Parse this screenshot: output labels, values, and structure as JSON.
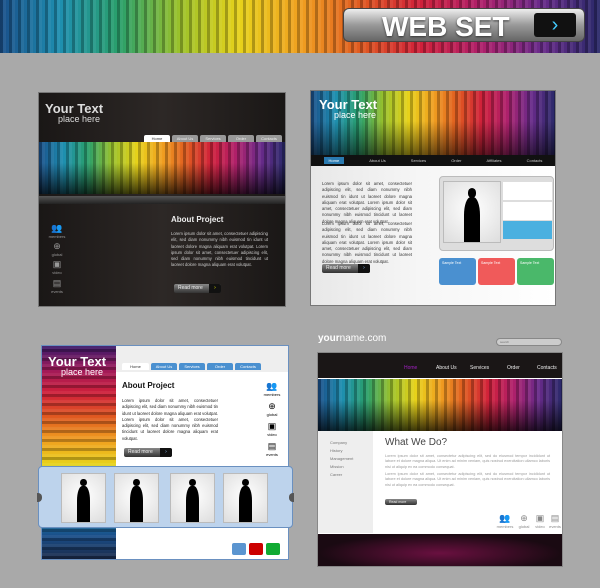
{
  "banner": {
    "title": "WEB SET",
    "arrow_icon": "chevron-right-icon"
  },
  "lorem1": "Lorem ipsum dolor sit amet, consectetuer adipiscing elit, sed diam nonummy nibh euismod tin idunt ut laoreet dolore magna aliquam erat volutpat. Lorem ipsum dolor sit amet, consectetuer adipiscing elit, sed diam nonummy nibh euismod tincidunt ut laoreet dolore magna aliquam erat volutpat.",
  "lorem2": "Lorem ipsum dolor sit amet, consectetur adipiscing elit, sed do eiusmod tempor incididunt ut labore et dolore magna aliqua. Ut enim ad minim veniam, quis nostrud exercitation ullamco laboris nisi ut aliquip ex ea commodo consequat.",
  "t1": {
    "logo1": "Your Text",
    "logo2": "place here",
    "tabs": [
      "Home",
      "About Us",
      "Services",
      "Order",
      "Contacts"
    ],
    "heading": "About Project",
    "button": "Read more",
    "icons": [
      "members",
      "global",
      "video",
      "events"
    ]
  },
  "t2": {
    "logo1": "Your Text",
    "logo2": "place here",
    "nav": [
      "Home",
      "About Us",
      "Services",
      "Order",
      "Affiliates",
      "Contacts"
    ],
    "button": "Read more",
    "cards": [
      "Sample Text",
      "Sample Text",
      "Sample Text"
    ],
    "card_colors": [
      "#4a90d0",
      "#f05a5a",
      "#4ab86a"
    ]
  },
  "t3": {
    "logo1": "Your Text",
    "logo2": "place here",
    "tabs": [
      "Home",
      "About Us",
      "Services",
      "Order",
      "Contacts"
    ],
    "heading": "About Project",
    "button": "Read more",
    "icons": [
      "members",
      "global",
      "video",
      "events"
    ],
    "swatches": [
      "#5b95d0",
      "#cc0000",
      "#11aa33"
    ]
  },
  "t4": {
    "domain_bold": "your",
    "domain_rest": "name.com",
    "search_placeholder": "search",
    "nav": [
      "Home",
      "About Us",
      "Services",
      "Order",
      "Contacts"
    ],
    "side": [
      "Company",
      "History",
      "Management",
      "Mission",
      "Career"
    ],
    "heading": "What We Do?",
    "button": "Read more",
    "icons": [
      "members",
      "global",
      "video",
      "events"
    ],
    "accent": "#a020c0"
  }
}
